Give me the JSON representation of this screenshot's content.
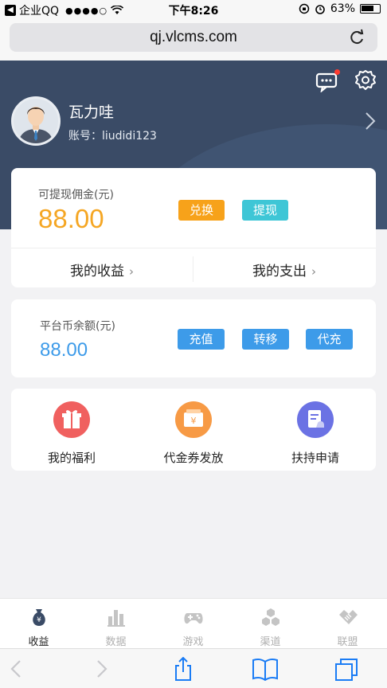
{
  "status_bar": {
    "back_app": "企业QQ",
    "signal": "●●●●○",
    "time": "下午8:26",
    "battery": "63%"
  },
  "browser": {
    "url": "qj.vlcms.com"
  },
  "profile": {
    "name": "瓦力哇",
    "account": "账号：liudidi123"
  },
  "commission": {
    "label": "可提现佣金(元)",
    "amount": "88.00",
    "exchange_label": "兑换",
    "withdraw_label": "提现",
    "income_link": "我的收益",
    "expense_link": "我的支出"
  },
  "platform": {
    "label": "平台币余额(元)",
    "amount": "88.00",
    "recharge_label": "充值",
    "transfer_label": "转移",
    "proxy_recharge_label": "代充"
  },
  "features": [
    {
      "label": "我的福利",
      "icon": "gift-icon",
      "color": "#f0605f"
    },
    {
      "label": "代金券发放",
      "icon": "voucher-icon",
      "color": "#f79a45"
    },
    {
      "label": "扶持申请",
      "icon": "application-icon",
      "color": "#6b72e4"
    }
  ],
  "tabs": [
    {
      "label": "收益",
      "icon": "money-bag-icon",
      "active": true
    },
    {
      "label": "数据",
      "icon": "bar-chart-icon",
      "active": false
    },
    {
      "label": "游戏",
      "icon": "gamepad-icon",
      "active": false
    },
    {
      "label": "渠道",
      "icon": "hexagons-icon",
      "active": false
    },
    {
      "label": "联盟",
      "icon": "handshake-icon",
      "active": false
    }
  ],
  "colors": {
    "header_bg": "#3a4b66",
    "orange": "#f5a623",
    "blue": "#3d9be9",
    "teal": "#3ec6d6"
  }
}
